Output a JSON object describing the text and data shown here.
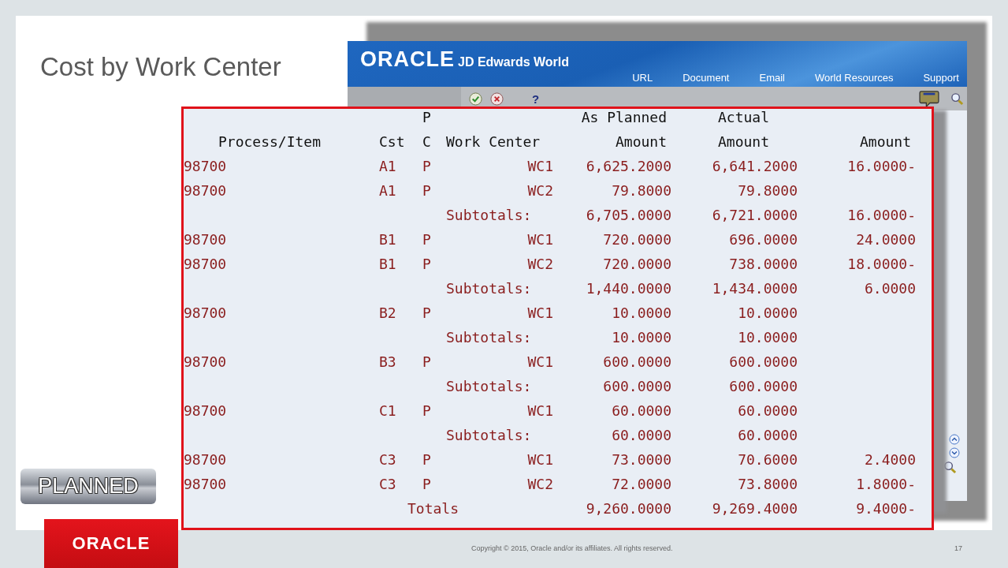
{
  "slide": {
    "title": "Cost by Work Center",
    "badge": "PLANNED",
    "logo": "ORACLE",
    "copyright": "Copyright © 2015, Oracle and/or its affiliates. All rights reserved.",
    "page_number": "17"
  },
  "app": {
    "brand": "ORACLE",
    "product": "JD Edwards World",
    "nav": [
      "URL",
      "Document",
      "Email",
      "World Resources",
      "Support"
    ],
    "help": "?"
  },
  "table": {
    "columns": [
      {
        "bottom": "Process/Item"
      },
      {
        "bottom": "Cst"
      },
      {
        "top": "P",
        "bottom": "C"
      },
      {
        "bottom": "Work Center"
      },
      {
        "top": "As Planned",
        "bottom": "Amount"
      },
      {
        "top": "Actual",
        "bottom": "Amount"
      },
      {
        "bottom": "Amount"
      }
    ],
    "rows": [
      {
        "kind": "item",
        "item": "98700",
        "cst": "A1",
        "pc": "P",
        "wc": "WC1",
        "planned": "6,625.2000",
        "actual": "6,641.2000",
        "amount": "16.0000-"
      },
      {
        "kind": "item",
        "item": "98700",
        "cst": "A1",
        "pc": "P",
        "wc": "WC2",
        "planned": "79.8000",
        "actual": "79.8000"
      },
      {
        "kind": "subtotal",
        "label": "Subtotals:",
        "planned": "6,705.0000",
        "actual": "6,721.0000",
        "amount": "16.0000-"
      },
      {
        "kind": "item",
        "item": "98700",
        "cst": "B1",
        "pc": "P",
        "wc": "WC1",
        "planned": "720.0000",
        "actual": "696.0000",
        "amount": "24.0000"
      },
      {
        "kind": "item",
        "item": "98700",
        "cst": "B1",
        "pc": "P",
        "wc": "WC2",
        "planned": "720.0000",
        "actual": "738.0000",
        "amount": "18.0000-"
      },
      {
        "kind": "subtotal",
        "label": "Subtotals:",
        "planned": "1,440.0000",
        "actual": "1,434.0000",
        "amount": "6.0000"
      },
      {
        "kind": "item",
        "item": "98700",
        "cst": "B2",
        "pc": "P",
        "wc": "WC1",
        "planned": "10.0000",
        "actual": "10.0000"
      },
      {
        "kind": "subtotal",
        "label": "Subtotals:",
        "planned": "10.0000",
        "actual": "10.0000"
      },
      {
        "kind": "item",
        "item": "98700",
        "cst": "B3",
        "pc": "P",
        "wc": "WC1",
        "planned": "600.0000",
        "actual": "600.0000"
      },
      {
        "kind": "subtotal",
        "label": "Subtotals:",
        "planned": "600.0000",
        "actual": "600.0000"
      },
      {
        "kind": "item",
        "item": "98700",
        "cst": "C1",
        "pc": "P",
        "wc": "WC1",
        "planned": "60.0000",
        "actual": "60.0000"
      },
      {
        "kind": "subtotal",
        "label": "Subtotals:",
        "planned": "60.0000",
        "actual": "60.0000"
      },
      {
        "kind": "item",
        "item": "98700",
        "cst": "C3",
        "pc": "P",
        "wc": "WC1",
        "planned": "73.0000",
        "actual": "70.6000",
        "amount": "2.4000"
      },
      {
        "kind": "item",
        "item": "98700",
        "cst": "C3",
        "pc": "P",
        "wc": "WC2",
        "planned": "72.0000",
        "actual": "73.8000",
        "amount": "1.8000-"
      },
      {
        "kind": "total",
        "label": "Totals",
        "planned": "9,260.0000",
        "actual": "9,269.4000",
        "amount": "9.4000-"
      }
    ]
  }
}
